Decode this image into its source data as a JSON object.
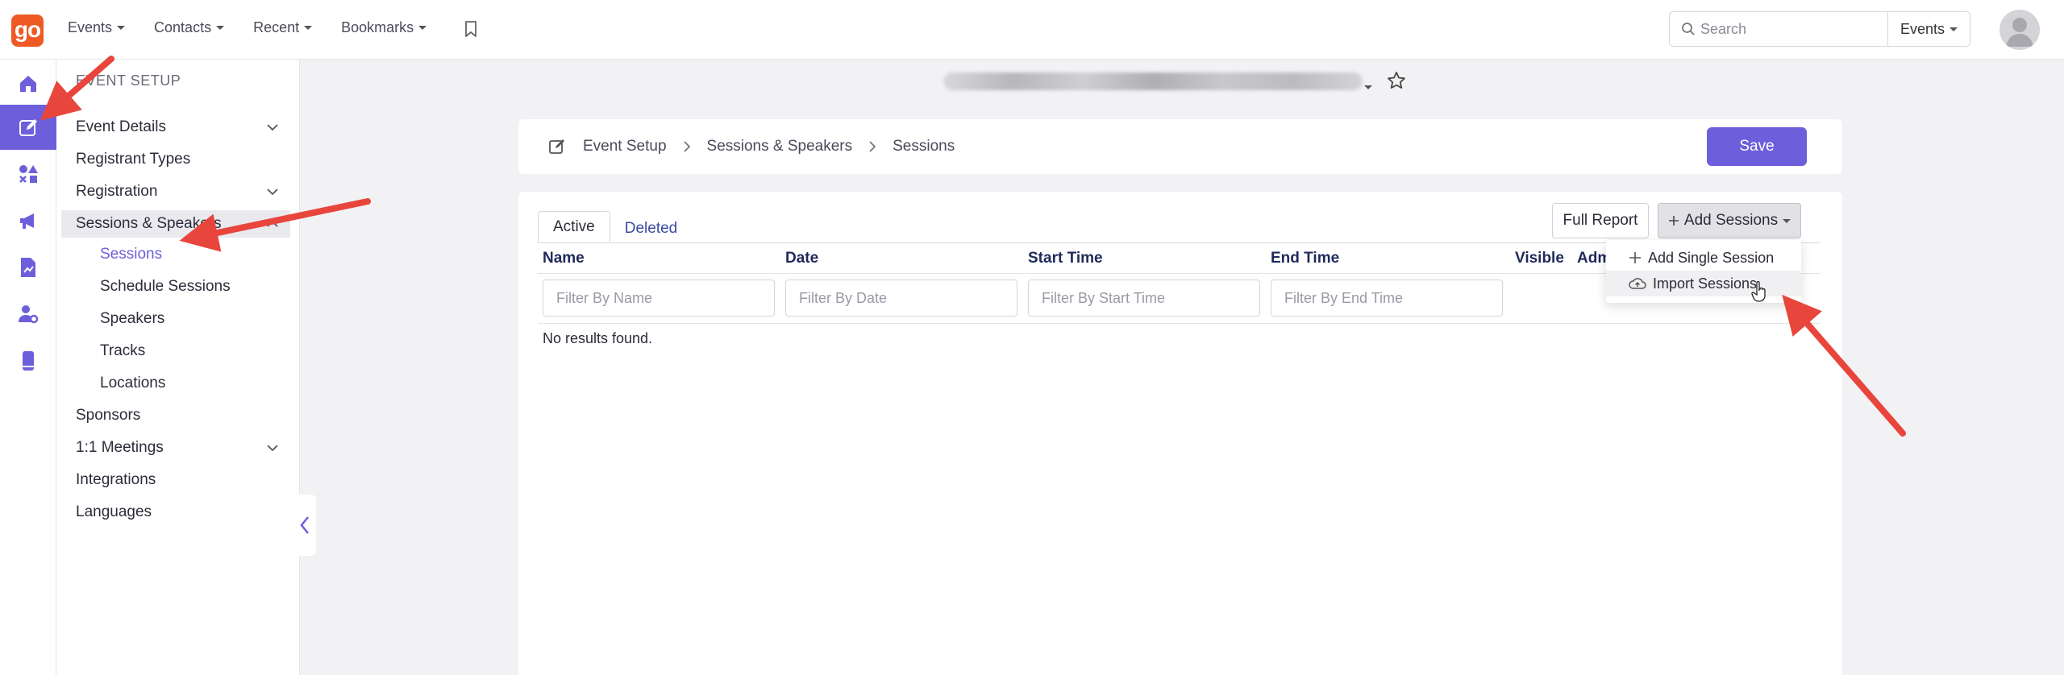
{
  "topbar": {
    "logo_text": "go",
    "nav": [
      {
        "label": "Events"
      },
      {
        "label": "Contacts"
      },
      {
        "label": "Recent"
      },
      {
        "label": "Bookmarks"
      }
    ],
    "search_placeholder": "Search",
    "search_scope": "Events"
  },
  "rail": {
    "icons": [
      "home-icon",
      "edit-icon",
      "shapes-icon",
      "megaphone-icon",
      "report-icon",
      "user-settings-icon",
      "mobile-icon"
    ],
    "active_index": 1
  },
  "subnav": {
    "heading": "EVENT SETUP",
    "items": [
      {
        "label": "Event Details",
        "chevron": "down"
      },
      {
        "label": "Registrant Types"
      },
      {
        "label": "Registration",
        "chevron": "down"
      },
      {
        "label": "Sessions & Speakers",
        "chevron": "up"
      },
      {
        "label": "Sessions"
      },
      {
        "label": "Schedule Sessions"
      },
      {
        "label": "Speakers"
      },
      {
        "label": "Tracks"
      },
      {
        "label": "Locations"
      },
      {
        "label": "Sponsors"
      },
      {
        "label": "1:1 Meetings",
        "chevron": "down"
      },
      {
        "label": "Integrations"
      },
      {
        "label": "Languages"
      }
    ]
  },
  "breadcrumb": {
    "items": [
      "Event Setup",
      "Sessions & Speakers",
      "Sessions"
    ],
    "save_label": "Save"
  },
  "tabs": {
    "active": "Active",
    "deleted": "Deleted"
  },
  "toolbar": {
    "full_report": "Full Report",
    "add_sessions": "Add Sessions"
  },
  "table": {
    "columns": [
      "Name",
      "Date",
      "Start Time",
      "End Time",
      "Visible",
      "Adm"
    ],
    "filters": [
      "Filter By Name",
      "Filter By Date",
      "Filter By Start Time",
      "Filter By End Time"
    ],
    "empty_message": "No results found."
  },
  "dropdown": {
    "items": [
      {
        "label": "Add Single Session",
        "icon": "plus-icon"
      },
      {
        "label": "Import Sessions",
        "icon": "cloud-upload-icon"
      }
    ]
  },
  "colors": {
    "accent": "#6d5fdb",
    "logo": "#ee5a24",
    "annotation_arrow": "#e8453c"
  }
}
